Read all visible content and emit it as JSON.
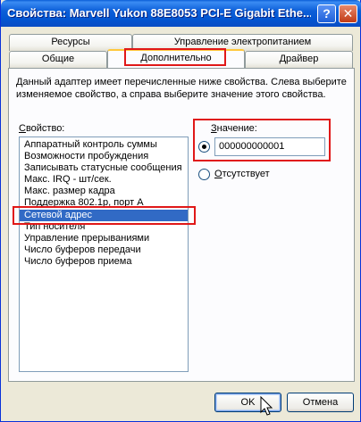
{
  "window": {
    "title": "Свойства: Marvell Yukon 88E8053 PCI-E Gigabit Ethe..."
  },
  "titlebar_buttons": {
    "help": "?",
    "close": "✕"
  },
  "tabs": {
    "row1": [
      "Ресурсы",
      "Управление электропитанием"
    ],
    "row2": [
      "Общие",
      "Дополнительно",
      "Драйвер"
    ],
    "active": "Дополнительно"
  },
  "description": "Данный адаптер имеет перечисленные ниже свойства. Слева выберите изменяемое свойство, а справа выберите значение этого свойства.",
  "property": {
    "label": "Свойство:",
    "items": [
      "Аппаратный контроль суммы",
      "Возможности пробуждения",
      "Записывать статусные сообщения",
      "Макс. IRQ - шт/сек.",
      "Макс. размер кадра",
      "Поддержка 802.1p, порт A",
      "Сетевой адрес",
      "Тип носителя",
      "Управление прерываниями",
      "Число буферов передачи",
      "Число буферов приема"
    ],
    "selected": "Сетевой адрес"
  },
  "value": {
    "label": "Значение:",
    "input_value": "000000000001",
    "absent_label": "Отсутствует",
    "selected_option": "value"
  },
  "buttons": {
    "ok": "OK",
    "cancel": "Отмена"
  },
  "colors": {
    "highlight": "#e01818",
    "selection": "#316ac5",
    "titlebar": "#0356d2"
  }
}
